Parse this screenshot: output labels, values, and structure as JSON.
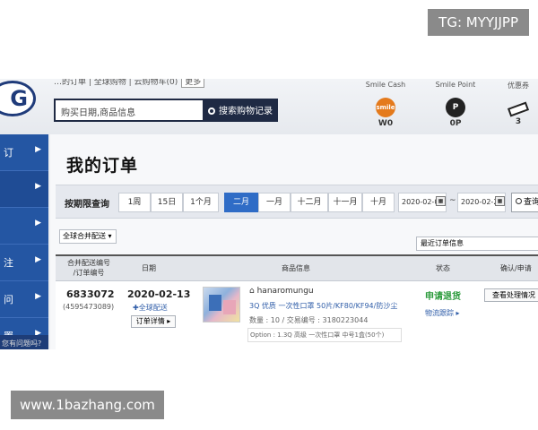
{
  "watermarks": {
    "top": "TG: MYYJJPP",
    "bottom": "www.1bazhang.com"
  },
  "header": {
    "logo": "G",
    "notice": "…的订单 | 全球购物 | 云购物车(0)",
    "notice_btn": "更多",
    "search_placeholder": "购买日期,商品信息",
    "search_button": "搜索购物记录",
    "stats": [
      {
        "label": "Smile Cash",
        "icon": "smile-cash-icon",
        "icon_text": "smile",
        "value": "W0"
      },
      {
        "label": "Smile Point",
        "icon": "point-icon",
        "icon_text": "P",
        "value": "0P"
      },
      {
        "label": "优惠券",
        "icon": "coupon-icon",
        "icon_text": "",
        "value": "3"
      }
    ]
  },
  "sidebar": {
    "items": [
      {
        "label": "订",
        "active": false
      },
      {
        "label": "",
        "active": true
      },
      {
        "label": "",
        "active": false
      },
      {
        "label": "注",
        "active": false
      },
      {
        "label": "问",
        "active": false
      },
      {
        "label": "置",
        "active": false
      }
    ],
    "bottom_text": "您有问题吗?"
  },
  "main": {
    "title": "我的订单",
    "filter": {
      "label": "按期限查询",
      "periods": [
        {
          "label": "1周",
          "active": false
        },
        {
          "label": "15日",
          "active": false
        },
        {
          "label": "1个月",
          "active": false
        },
        {
          "label": "二月",
          "active": true
        },
        {
          "label": "一月",
          "active": false
        },
        {
          "label": "十二月",
          "active": false
        },
        {
          "label": "十一月",
          "active": false
        },
        {
          "label": "十月",
          "active": false
        }
      ],
      "date_from": "2020-02-0",
      "date_to": "2020-02-2",
      "query_button": "查询"
    },
    "merge_select": "全球合并配送",
    "sort_select": "最近订单信息",
    "table_headers": [
      "合并配送编号\n/订单编号",
      "日期",
      "商品信息",
      "状态",
      "确认/申请"
    ],
    "order": {
      "number": "6833072",
      "sub_number": "(4595473089)",
      "date": "2020-02-13",
      "shipping": "全球配送",
      "detail_button": "订单详情",
      "seller": "hanaromungu",
      "product_name": "3Q 优质 一次性口罩 50片/KF80/KF94/防沙尘",
      "meta": "数量 : 10 / 交易编号 : 3180223044",
      "option": "Option : 1.3Q 高级 一次性口罩 中号1盒(50个)",
      "status": "申请退货",
      "tracking": "物流跟踪",
      "check_button": "查看处理情况"
    }
  }
}
